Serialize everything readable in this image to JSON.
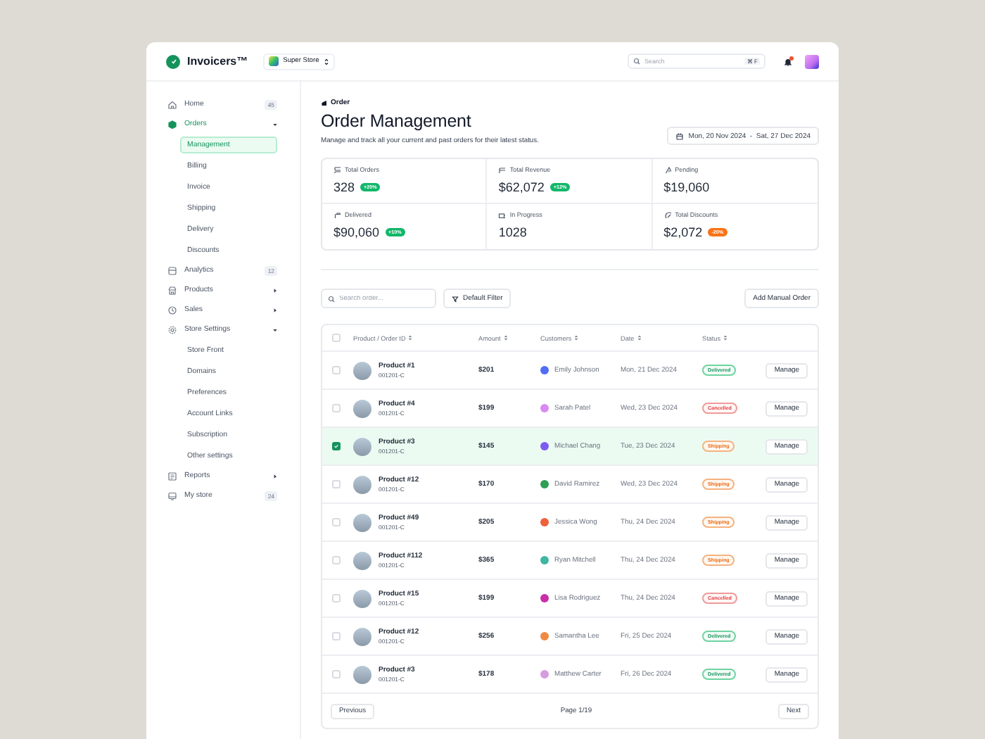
{
  "topbar": {
    "brand": "Invoicers™",
    "store": "Super Store",
    "search": {
      "placeholder": "Search",
      "shortcut": "⌘ F"
    },
    "notifications": {
      "unread": true
    }
  },
  "sidebar": {
    "items": [
      {
        "label": "Home",
        "badge": "45",
        "selected": false
      },
      {
        "label": "Orders",
        "expanded": true,
        "selected": true,
        "children": [
          {
            "label": "Management",
            "selected": true
          },
          {
            "label": "Billing",
            "selected": false
          },
          {
            "label": "Invoice",
            "selected": false
          },
          {
            "label": "Shipping",
            "selected": false
          },
          {
            "label": "Delivery",
            "selected": false
          },
          {
            "label": "Discounts",
            "selected": false
          }
        ]
      },
      {
        "label": "Analytics",
        "badge": "12",
        "selected": false
      },
      {
        "label": "Products",
        "expanded": false,
        "selected": false
      },
      {
        "label": "Sales",
        "expanded": false,
        "selected": false
      },
      {
        "label": "Store Settings",
        "expanded": true,
        "selected": false,
        "children": [
          {
            "label": "Store Front",
            "selected": false
          },
          {
            "label": "Domains",
            "selected": false
          },
          {
            "label": "Preferences",
            "selected": false
          },
          {
            "label": "Account Links",
            "selected": false
          },
          {
            "label": "Subscription",
            "selected": false
          },
          {
            "label": "Other settings",
            "selected": false
          }
        ]
      },
      {
        "label": "Reports",
        "expanded": false,
        "selected": false
      },
      {
        "label": "My store",
        "badge": "24",
        "selected": false
      }
    ]
  },
  "page": {
    "breadcrumb": "Order",
    "title": "Order Management",
    "description": "Manage and track all your current and past orders for their latest status.",
    "date_range": "Mon, 20 Nov 2024  -  Sat, 27 Dec 2024"
  },
  "stats": [
    {
      "label": "Total Orders",
      "value": "328",
      "change": "+20%",
      "kind": "up"
    },
    {
      "label": "Total Revenue",
      "value": "$62,072",
      "change": "+12%",
      "kind": "up"
    },
    {
      "label": "Pending",
      "value": "$19,060"
    },
    {
      "label": "Delivered",
      "value": "$90,060",
      "change": "+10%",
      "kind": "up"
    },
    {
      "label": "In Progress",
      "value": "1028"
    },
    {
      "label": "Total Discounts",
      "value": "$2,072",
      "change": "-20%",
      "kind": "down"
    }
  ],
  "toolbar": {
    "search_placeholder": "Search order...",
    "filter": "Default Filter",
    "add_button": "Add Manual Order"
  },
  "table": {
    "all_selected": false,
    "columns": [
      "Product / Order ID",
      "Amount",
      "Customers",
      "Date",
      "Status"
    ],
    "rows": [
      {
        "selected": false,
        "product": "Product #1",
        "order_id": "001201-C",
        "amount": "$201",
        "customer": "Emily Johnson",
        "color": "#4f6df5",
        "date": "Mon, 21 Dec 2024",
        "status": {
          "label": "Delivered",
          "kind": "delivered"
        },
        "action": "Manage"
      },
      {
        "selected": false,
        "product": "Product #4",
        "order_id": "001201-C",
        "amount": "$199",
        "customer": "Sarah Patel",
        "color": "#d98af0",
        "date": "Wed, 23 Dec 2024",
        "status": {
          "label": "Cancelled",
          "kind": "cancelled"
        },
        "action": "Manage"
      },
      {
        "selected": true,
        "product": "Product #3",
        "order_id": "001201-C",
        "amount": "$145",
        "customer": "Michael Chang",
        "color": "#7c5cf0",
        "date": "Tue, 23 Dec 2024",
        "status": {
          "label": "Shipping",
          "kind": "shipping"
        },
        "action": "Manage"
      },
      {
        "selected": false,
        "product": "Product #12",
        "order_id": "001201-C",
        "amount": "$170",
        "customer": "David Ramirez",
        "color": "#2f9e57",
        "date": "Wed, 23 Dec 2024",
        "status": {
          "label": "Shipping",
          "kind": "shipping"
        },
        "action": "Manage"
      },
      {
        "selected": false,
        "product": "Product #49",
        "order_id": "001201-C",
        "amount": "$205",
        "customer": "Jessica Wong",
        "color": "#f0603a",
        "date": "Thu, 24 Dec 2024",
        "status": {
          "label": "Shipping",
          "kind": "shipping"
        },
        "action": "Manage"
      },
      {
        "selected": false,
        "product": "Product #112",
        "order_id": "001201-C",
        "amount": "$365",
        "customer": "Ryan Mitchell",
        "color": "#3fb7a0",
        "date": "Thu, 24 Dec 2024",
        "status": {
          "label": "Shipping",
          "kind": "shipping"
        },
        "action": "Manage"
      },
      {
        "selected": false,
        "product": "Product #15",
        "order_id": "001201-C",
        "amount": "$199",
        "customer": "Lisa Rodriguez",
        "color": "#c92ea8",
        "date": "Thu, 24 Dec 2024",
        "status": {
          "label": "Cancelled",
          "kind": "cancelled"
        },
        "action": "Manage"
      },
      {
        "selected": false,
        "product": "Product #12",
        "order_id": "001201-C",
        "amount": "$256",
        "customer": "Samantha Lee",
        "color": "#ef8a45",
        "date": "Fri, 25 Dec 2024",
        "status": {
          "label": "Delivered",
          "kind": "delivered"
        },
        "action": "Manage"
      },
      {
        "selected": false,
        "product": "Product #3",
        "order_id": "001201-C",
        "amount": "$178",
        "customer": "Matthew Carter",
        "color": "#d79be0",
        "date": "Fri, 26 Dec 2024",
        "status": {
          "label": "Delivered",
          "kind": "delivered"
        },
        "action": "Manage"
      }
    ]
  },
  "pagination": {
    "previous": "Previous",
    "page": "Page 1/19",
    "next": "Next"
  }
}
